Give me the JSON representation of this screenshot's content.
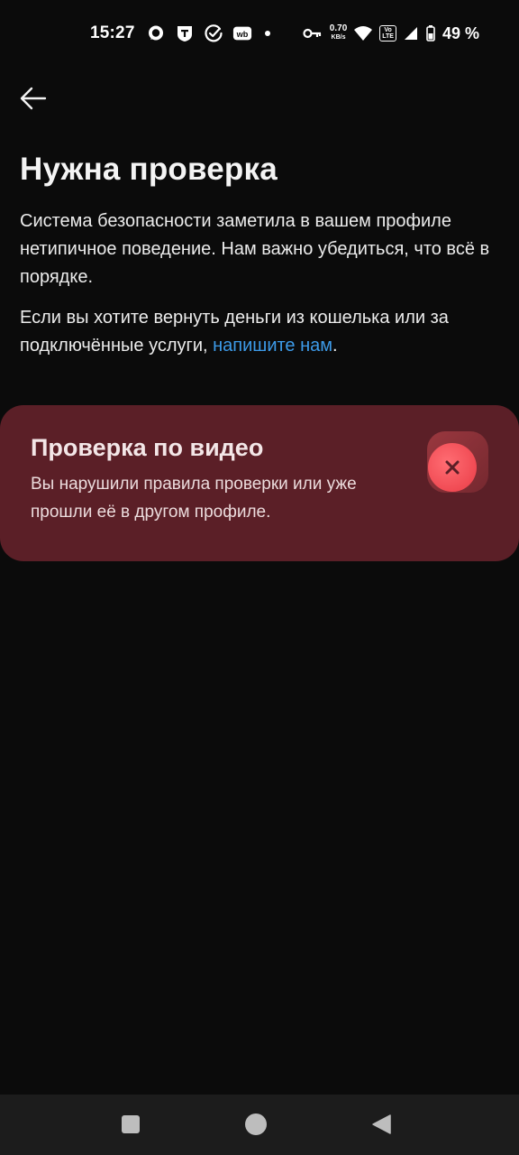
{
  "status_bar": {
    "time": "15:27",
    "speed_value": "0.70",
    "speed_unit": "KB/s",
    "volte_top": "Vo",
    "volte_bottom": "LTE",
    "battery": "49 %"
  },
  "header": {
    "title": "Нужна проверка"
  },
  "body": {
    "paragraph_1": "Система безопасности заметила в вашем профиле нетипичное поведение. Нам важно убедиться, что всё в порядке.",
    "paragraph_2_prefix": "Если вы хотите вернуть деньги из кошелька или за подключённые услуги, ",
    "paragraph_2_link": "напишите нам",
    "paragraph_2_suffix": "."
  },
  "video_check": {
    "title": "Проверка по видео",
    "description": "Вы нарушили правила проверки или уже прошли её в другом профиле.",
    "status_icon": "x-icon"
  },
  "colors": {
    "background": "#0b0b0b",
    "card": "#5b1f27",
    "link": "#3d9be9",
    "error": "#f04a53"
  }
}
